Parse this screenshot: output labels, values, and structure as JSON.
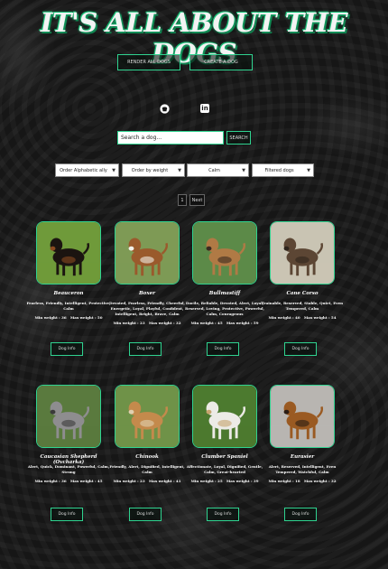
{
  "header": {
    "title": "IT'S ALL ABOUT THE DOGS"
  },
  "nav": {
    "render_all": "RENDER ALL DOGS",
    "create": "CREATE A DOG"
  },
  "social": {
    "icons": [
      "github-icon",
      "linkedin-icon"
    ],
    "linkedin_text": "in"
  },
  "search": {
    "placeholder": "Search a dog...",
    "button": "SEARCH"
  },
  "filters": {
    "order_alpha": "Order Alphabetic ally",
    "order_weight": "Order by weight",
    "temperament": "Calm",
    "filtered": "Filtered dogs"
  },
  "pagination": {
    "page": "1",
    "next": "Next"
  },
  "card_button": "Dog Info",
  "dogs": [
    {
      "name": "Beauceron",
      "temperament": "Fearless, Friendly, Intelligent, Protective, Calm",
      "min": "Min weight : 36",
      "max": "Max weight : 50",
      "colors": {
        "bg": "#6f9a3a",
        "dog": "#1b1410",
        "accent": "#8a4a20"
      }
    },
    {
      "name": "Boxer",
      "temperament": "Devoted, Fearless, Friendly, Cheerful, Energetic, Loyal, Playful, Confident, Intelligent, Bright, Brave, Calm",
      "min": "Min weight : 23",
      "max": "Max weight : 32",
      "colors": {
        "bg": "#7e9a55",
        "dog": "#9a5a2c",
        "accent": "#f2efe8"
      }
    },
    {
      "name": "Bullmastiff",
      "temperament": "Docile, Reliable, Devoted, Alert, Loyal, Reserved, Loving, Protective, Powerful, Calm, Courageous",
      "min": "Min weight : 45",
      "max": "Max weight : 59",
      "colors": {
        "bg": "#5c8a48",
        "dog": "#b07a45",
        "accent": "#3a2a20"
      }
    },
    {
      "name": "Cane Corso",
      "temperament": "Trainable, Reserved, Stable, Quiet, Even Tempered, Calm",
      "min": "Min weight : 40",
      "max": "Max weight : 54",
      "colors": {
        "bg": "#c9c4b3",
        "dog": "#5c4634",
        "accent": "#2e241c"
      }
    },
    {
      "name": "Caucasian Shepherd (Ovcharka)",
      "temperament": "Alert, Quick, Dominant, Powerful, Calm, Strong",
      "min": "Min weight : 36",
      "max": "Max weight : 45",
      "colors": {
        "bg": "#5a7a3e",
        "dog": "#8e8d8f",
        "accent": "#3a3a3a"
      }
    },
    {
      "name": "Chinook",
      "temperament": "Friendly, Alert, Dignified, Intelligent, Calm",
      "min": "Min weight : 23",
      "max": "Max weight : 41",
      "colors": {
        "bg": "#6f9248",
        "dog": "#c48a4c",
        "accent": "#e0d0b0"
      }
    },
    {
      "name": "Clumber Spaniel",
      "temperament": "Affectionate, Loyal, Dignified, Gentle, Calm, Great-hearted",
      "min": "Min weight : 25",
      "max": "Max weight : 39",
      "colors": {
        "bg": "#4c7a2f",
        "dog": "#ecebe6",
        "accent": "#c7a46e"
      }
    },
    {
      "name": "Eurasier",
      "temperament": "Alert, Reserved, Intelligent, Even Tempered, Watchful, Calm",
      "min": "Min weight : 18",
      "max": "Max weight : 32",
      "colors": {
        "bg": "#b8b5b1",
        "dog": "#9a5a22",
        "accent": "#2a1c14"
      }
    }
  ],
  "colors": {
    "accent": "#2fd390",
    "background": "#161616"
  }
}
